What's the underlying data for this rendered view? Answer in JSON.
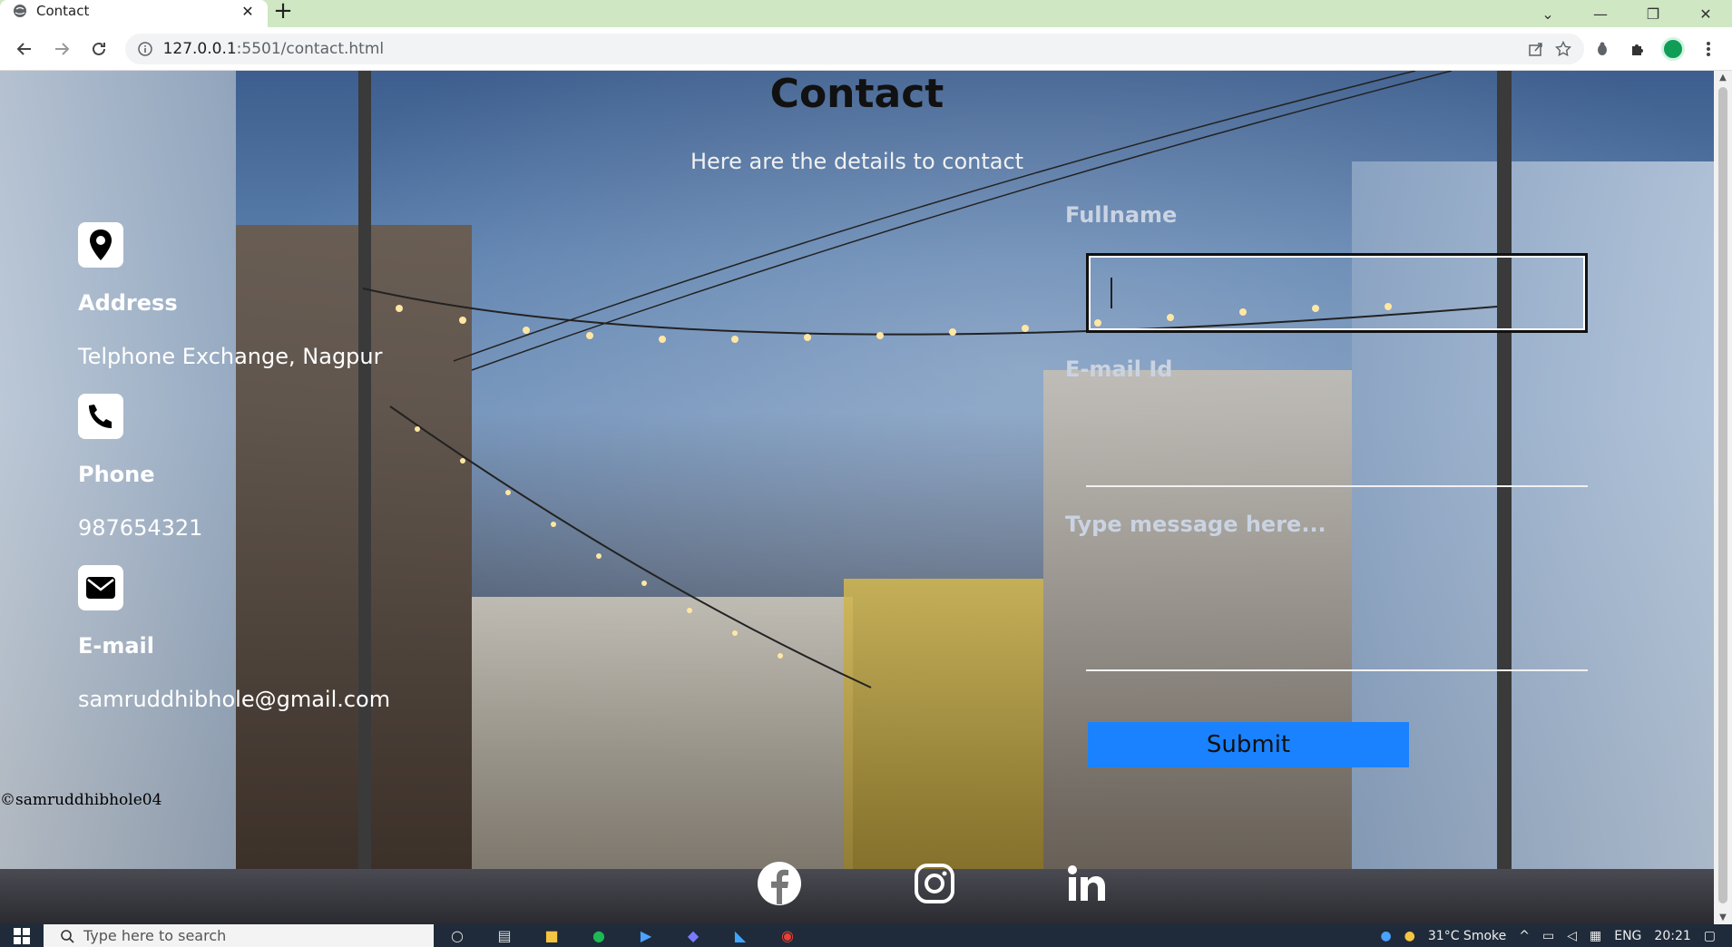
{
  "browser": {
    "tab_title": "Contact",
    "tab_close": "✕",
    "new_tab": "+",
    "url_host": "127.0.0.1",
    "url_path": ":5501/contact.html",
    "window_minimize": "—",
    "window_restore": "❐",
    "window_close": "✕",
    "tab_list": "⌄"
  },
  "page": {
    "title": "Contact",
    "subtitle": "Here are the details to contact",
    "address_label": "Address",
    "address_value": "Telphone Exchange, Nagpur",
    "phone_label": "Phone",
    "phone_value": "987654321",
    "email_label": "E-mail",
    "email_value": "samruddhibhole@gmail.com",
    "copyright": "©samruddhibhole04"
  },
  "form": {
    "fullname_label": "Fullname",
    "email_label": "E-mail Id",
    "message_label": "Type message here...",
    "submit_label": "Submit"
  },
  "social": [
    "facebook-icon",
    "instagram-icon",
    "linkedin-icon"
  ],
  "taskbar": {
    "search_placeholder": "Type here to search",
    "weather": "31°C  Smoke",
    "lang": "ENG",
    "time": "20:21"
  },
  "colors": {
    "submit_bg": "#1a82ff",
    "tabbar_bg": "#cfe7c3"
  }
}
